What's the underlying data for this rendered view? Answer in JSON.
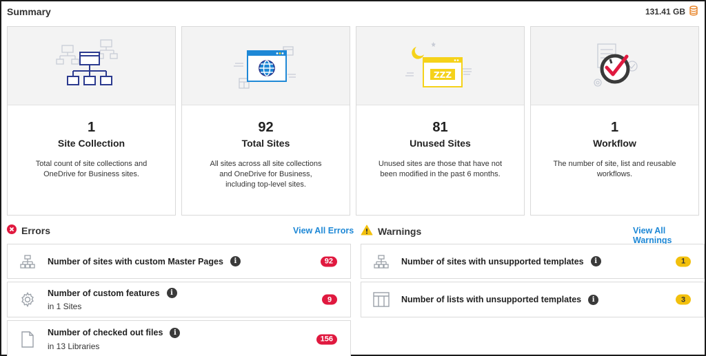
{
  "header": {
    "title": "Summary",
    "storage": "131.41 GB"
  },
  "cards": [
    {
      "count": "1",
      "title": "Site Collection",
      "desc": "Total count of site collections and OneDrive for Business sites.",
      "icon": "site-hierarchy"
    },
    {
      "count": "92",
      "title": "Total Sites",
      "desc": "All sites across all site collections and OneDrive for Business, including top-level sites.",
      "icon": "browser-globe"
    },
    {
      "count": "81",
      "title": "Unused Sites",
      "desc": "Unused sites are those that have not been modified in the past 6 months.",
      "icon": "sleeping-window"
    },
    {
      "count": "1",
      "title": "Workflow",
      "desc": "The number of site, list and reusable workflows.",
      "icon": "workflow-check"
    }
  ],
  "errors": {
    "heading": "Errors",
    "link": "View All Errors",
    "items": [
      {
        "label": "Number of sites with custom Master Pages",
        "sub": "",
        "count": "92",
        "icon": "site-tree"
      },
      {
        "label": "Number of custom features",
        "sub": "in 1 Sites",
        "count": "9",
        "icon": "gear"
      },
      {
        "label": "Number of checked out files",
        "sub": "in 13 Libraries",
        "count": "156",
        "icon": "file"
      }
    ]
  },
  "warnings": {
    "heading": "Warnings",
    "link": "View All Warnings",
    "items": [
      {
        "label": "Number of sites with unsupported templates",
        "count": "1",
        "icon": "site-tree"
      },
      {
        "label": "Number of lists with unsupported templates",
        "count": "3",
        "icon": "list-columns"
      }
    ]
  },
  "colors": {
    "error": "#e0193f",
    "warning": "#f2c00d",
    "link": "#1e88d6",
    "navy": "#2b3a8f",
    "blue": "#1e88d6",
    "yellow": "#f5d21a"
  }
}
